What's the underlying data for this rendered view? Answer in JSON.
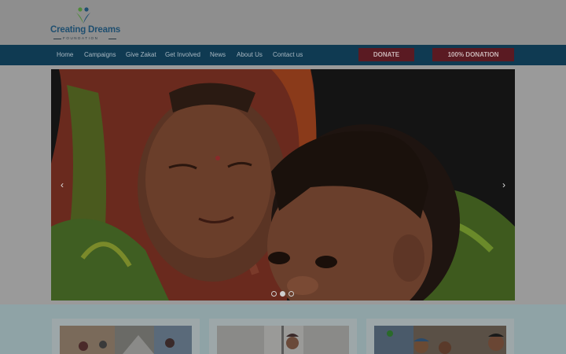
{
  "brand": {
    "name": "Creating Dreams",
    "tagline": "FOUNDATION"
  },
  "nav": {
    "items": [
      "Home",
      "Campaigns",
      "Give Zakat",
      "Get Involved",
      "News",
      "About Us",
      "Contact us"
    ],
    "donate_label": "DONATE",
    "full_donation_label": "100% DONATION"
  },
  "carousel": {
    "prev_icon": "chevron-left-icon",
    "next_icon": "chevron-right-icon",
    "slide_count": 3,
    "active_slide": 2
  },
  "colors": {
    "nav_bg": "#0f3a52",
    "donate_bg": "#5a1a22",
    "brand_blue": "#1f4f70",
    "brand_green": "#4f8a3a"
  }
}
